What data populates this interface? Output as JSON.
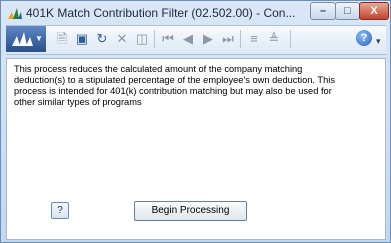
{
  "window": {
    "title": "401K Match Contribution Filter (02.502.00) - Con...",
    "controls": {
      "minimize": "–",
      "maximize": "□",
      "close": "X"
    }
  },
  "toolbar": {
    "icons": [
      "app-menu-icon",
      "new-icon",
      "save-icon",
      "refresh-icon",
      "delete-icon",
      "cut-icon",
      "first-record-icon",
      "previous-record-icon",
      "next-record-icon",
      "last-record-icon",
      "insert-icon",
      "clear-icon",
      "help-icon"
    ],
    "help_glyph": "?",
    "overflow_glyph": "▾"
  },
  "content": {
    "description": "This process reduces the calculated amount of the company matching deduction(s) to a stipulated percentage of the employee's own deduction.  This process is intended for 401(k) contribution matching but may also be used for other similar types of programs",
    "help_button": "?",
    "begin_button": "Begin Processing"
  }
}
